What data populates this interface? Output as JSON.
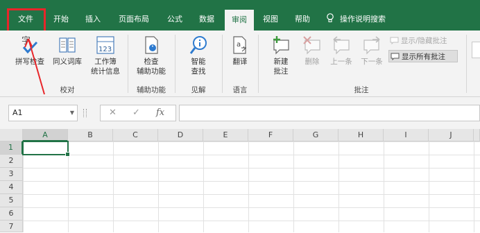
{
  "colors": {
    "accent": "#217346",
    "highlight": "#e8262a",
    "ribbon_bg": "#f3f3f3"
  },
  "tabs": [
    {
      "label": "文件"
    },
    {
      "label": "开始"
    },
    {
      "label": "插入"
    },
    {
      "label": "页面布局"
    },
    {
      "label": "公式"
    },
    {
      "label": "数据"
    },
    {
      "label": "审阅"
    },
    {
      "label": "视图"
    },
    {
      "label": "帮助"
    },
    {
      "label": "操作说明搜索",
      "icon": "lightbulb-icon"
    }
  ],
  "ribbon": {
    "spelling": {
      "line1": "拼写检查",
      "icon": "spelling-check-icon",
      "icon_text": "字"
    },
    "thesaurus": {
      "line1": "同义词库",
      "icon": "thesaurus-icon"
    },
    "workbook_stats": {
      "line1": "工作簿",
      "line2": "统计信息",
      "icon": "workbook-statistics-icon",
      "icon_text": "123"
    },
    "proofing_group": "校对",
    "accessibility": {
      "line1": "检查",
      "line2": "辅助功能",
      "icon": "check-accessibility-icon"
    },
    "accessibility_group": "辅助功能",
    "smart_lookup": {
      "line1": "智能",
      "line2": "查找",
      "icon": "smart-lookup-icon"
    },
    "insights_group": "见解",
    "translate": {
      "line1": "翻译",
      "icon": "translate-icon",
      "icon_text": "a"
    },
    "language_group": "语言",
    "new_comment": {
      "line1": "新建",
      "line2": "批注",
      "icon": "new-comment-icon"
    },
    "delete": {
      "line1": "删除",
      "icon": "delete-comment-icon"
    },
    "previous": {
      "line1": "上一条",
      "icon": "previous-comment-icon"
    },
    "next": {
      "line1": "下一条",
      "icon": "next-comment-icon"
    },
    "show_hide_comment": "显示/隐藏批注",
    "show_all_comments": "显示所有批注",
    "comments_group": "批注"
  },
  "formula_bar": {
    "name_box": "A1",
    "fx": "fx",
    "value": ""
  },
  "sheet": {
    "columns": [
      "A",
      "B",
      "C",
      "D",
      "E",
      "F",
      "G",
      "H",
      "I",
      "J"
    ],
    "rows": [
      "1",
      "2",
      "3",
      "4",
      "5",
      "6",
      "7"
    ],
    "active_cell": "A1"
  }
}
